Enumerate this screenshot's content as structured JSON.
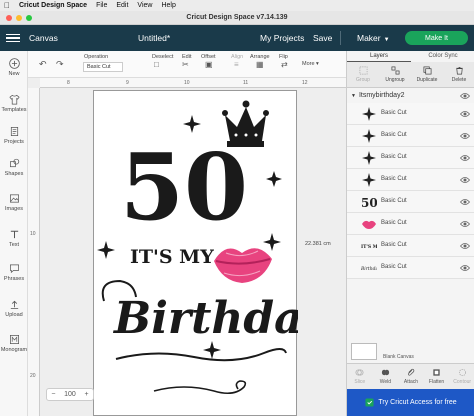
{
  "menubar": {
    "app_name": "Cricut Design Space",
    "items": [
      "File",
      "Edit",
      "View",
      "Help"
    ]
  },
  "window": {
    "title": "Cricut Design Space  v7.14.139"
  },
  "header": {
    "canvas_label": "Canvas",
    "doc_title": "Untitled*",
    "my_projects": "My Projects",
    "save": "Save",
    "machine": "Maker",
    "make_it": "Make It"
  },
  "left_tools": [
    {
      "label": "New",
      "icon": "plus-icon"
    },
    {
      "label": "Templates",
      "icon": "shirt-icon"
    },
    {
      "label": "Projects",
      "icon": "projects-icon"
    },
    {
      "label": "Shapes",
      "icon": "shapes-icon"
    },
    {
      "label": "Images",
      "icon": "images-icon"
    },
    {
      "label": "Text",
      "icon": "text-icon"
    },
    {
      "label": "Phrases",
      "icon": "phrases-icon"
    },
    {
      "label": "Upload",
      "icon": "upload-icon"
    },
    {
      "label": "Monogram",
      "icon": "monogram-icon"
    }
  ],
  "editbar": {
    "operation_label": "Operation",
    "operation_value": "Basic Cut",
    "deselect": "Deselect",
    "edit": "Edit",
    "offset": "Offset",
    "align": "Align",
    "arrange": "Arrange",
    "flip": "Flip",
    "more": "More"
  },
  "canvas": {
    "ruler_top_numbers": [
      "8",
      "9",
      "10",
      "11",
      "12"
    ],
    "ruler_left_numbers": [
      "10",
      "20"
    ],
    "height_label": "22.381 cm",
    "zoom_value": "100"
  },
  "artwork": {
    "number": "50",
    "tagline": "IT'S MY",
    "word": "Birthday"
  },
  "right_panel": {
    "tabs": [
      "Layers",
      "Color Sync"
    ],
    "actions": [
      "Group",
      "Ungroup",
      "Duplicate",
      "Delete"
    ],
    "group_name": "Itsmybirthday2",
    "layers": [
      {
        "name": "Basic Cut",
        "thumb": "star"
      },
      {
        "name": "Basic Cut",
        "thumb": "star"
      },
      {
        "name": "Basic Cut",
        "thumb": "star"
      },
      {
        "name": "Basic Cut",
        "thumb": "star"
      },
      {
        "name": "Basic Cut",
        "thumb": "50"
      },
      {
        "name": "Basic Cut",
        "thumb": "lips"
      },
      {
        "name": "Basic Cut",
        "thumb": "itsmy"
      },
      {
        "name": "Basic Cut",
        "thumb": "birthday"
      }
    ],
    "blank_canvas": "Blank Canvas",
    "bottom_actions": [
      "Slice",
      "Weld",
      "Attach",
      "Flatten",
      "Contour"
    ],
    "try_access": "Try Cricut Access for free"
  },
  "colors": {
    "header_bg": "#1a3a4a",
    "make_it_green": "#1aa45b",
    "access_blue": "#1e58c6",
    "lips_pink": "#e8437f"
  }
}
